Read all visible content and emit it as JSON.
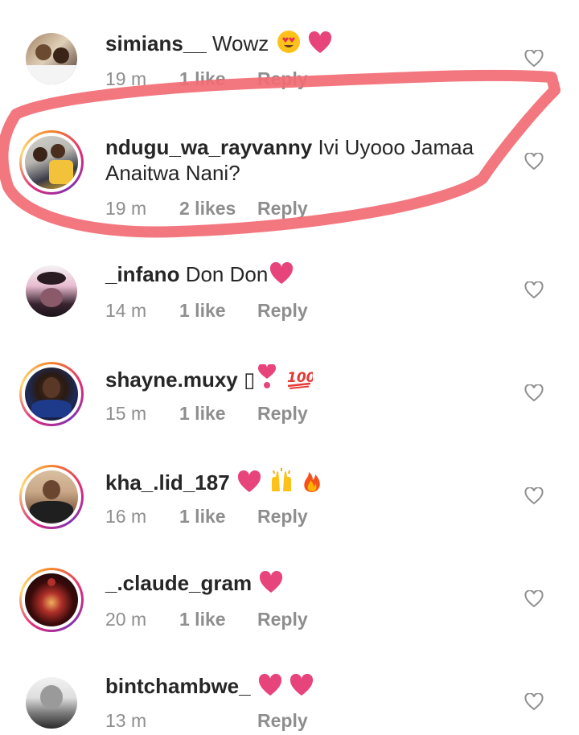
{
  "comments": [
    {
      "username": "simians__",
      "text": "Wowz",
      "emojis": [
        "heart-eyes",
        "heart"
      ],
      "time": "19 m",
      "likes": "1 like",
      "reply": "Reply",
      "story": false,
      "colors": [
        "#8a6a4a",
        "#d9c2a0",
        "#3d2a20"
      ]
    },
    {
      "username": "ndugu_wa_rayvanny",
      "text": "Ivi Uyooo Jamaa",
      "text2": "Anaitwa Nani?",
      "emojis": [],
      "time": "19 m",
      "likes": "2 likes",
      "reply": "Reply",
      "story": true,
      "colors": [
        "#c9c7c2",
        "#3a3a48",
        "#e4b02a"
      ]
    },
    {
      "username": "_infano",
      "text": "Don Don",
      "emojis": [
        "heart"
      ],
      "time": "14 m",
      "likes": "1 like",
      "reply": "Reply",
      "story": false,
      "colors": [
        "#d8a0b8",
        "#3a2430",
        "#f1f1f1"
      ]
    },
    {
      "username": "shayne.muxy",
      "text": "▯",
      "emojis": [
        "heart-exclamation",
        "hundred"
      ],
      "time": "15 m",
      "likes": "1 like",
      "reply": "Reply",
      "story": true,
      "colors": [
        "#1e2b5a",
        "#4a3020",
        "#0c0c14"
      ]
    },
    {
      "username": "kha_.lid_187",
      "text": "",
      "emojis": [
        "heart",
        "raised-hands",
        "fire"
      ],
      "time": "16 m",
      "likes": "1 like",
      "reply": "Reply",
      "story": true,
      "colors": [
        "#c9a888",
        "#2a2a2a",
        "#8f6b4f"
      ]
    },
    {
      "username": "_.claude_gram",
      "text": "",
      "emojis": [
        "heart"
      ],
      "time": "20 m",
      "likes": "1 like",
      "reply": "Reply",
      "story": true,
      "colors": [
        "#0a0a0a",
        "#b0302a",
        "#f0b060"
      ]
    },
    {
      "username": "bintchambwe_",
      "text": "",
      "emojis": [
        "heart",
        "heart"
      ],
      "time": "13 m",
      "likes": "",
      "reply": "Reply",
      "story": false,
      "colors": [
        "#dedede",
        "#7a7a7a",
        "#2a2a2a"
      ]
    }
  ],
  "accent": {
    "heart": "#e8447c",
    "highlight": "#f26b74"
  }
}
